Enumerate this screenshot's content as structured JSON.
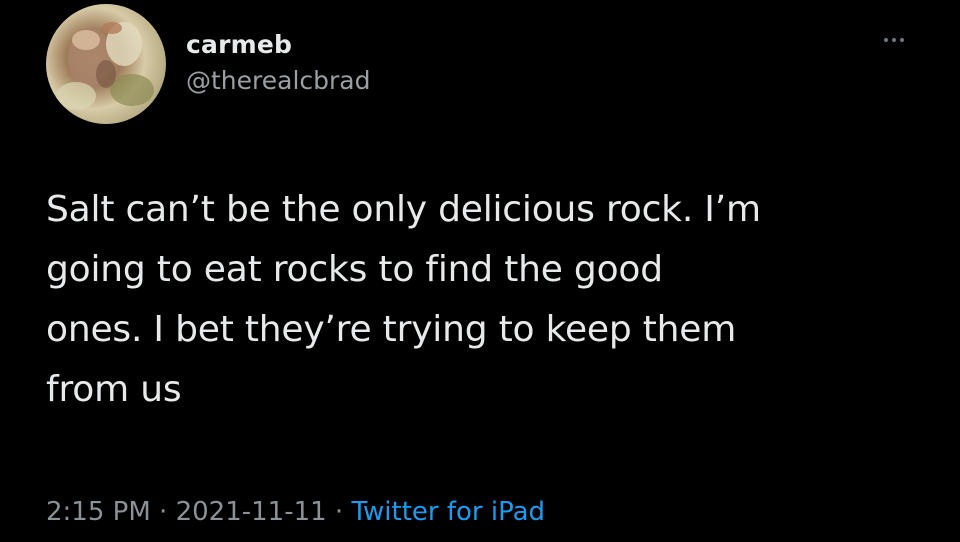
{
  "user": {
    "display_name": "carmeb",
    "handle": "@therealcbrad",
    "avatar_icon": "user-avatar-photo"
  },
  "tweet": {
    "text": "Salt can’t be the only delicious rock. I’m\ngoing to eat rocks to find the good\nones. I bet they’re trying to keep them\nfrom us"
  },
  "meta": {
    "time": "2:15 PM",
    "separator": " · ",
    "date": "2021-11-11",
    "source": "Twitter for iPad"
  },
  "colors": {
    "background": "#000000",
    "text": "#e7e9ea",
    "secondary": "#8b9197",
    "link": "#1d9bf0"
  },
  "icons": {
    "more": "more-horizontal-icon"
  }
}
